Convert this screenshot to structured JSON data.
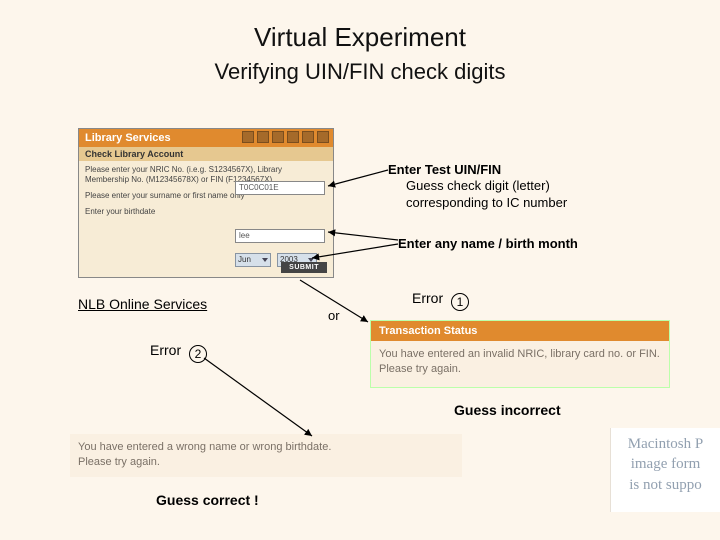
{
  "title": "Virtual Experiment",
  "subtitle": "Verifying UIN/FIN check digits",
  "form": {
    "header": "Library Services",
    "section": "Check Library Account",
    "prompt_nric": "Please enter your NRIC No. (i.e.g. S1234567X), Library Membership No. (M12345678X) or FIN (F1234567X)",
    "nric_value": "T0C0C01E",
    "prompt_name": "Please enter your surname or first name only",
    "name_value": "lee",
    "prompt_birth": "Enter your birthdate",
    "month": "Jun",
    "year": "2003",
    "submit": "SUBMIT"
  },
  "annotations": {
    "nric_title": "Enter Test UIN/FIN",
    "nric_sub1": "Guess check digit (letter)",
    "nric_sub2": "corresponding to IC number",
    "name": "Enter any name / birth month"
  },
  "nlb_label": "NLB Online Services",
  "or": "or",
  "error_label": "Error",
  "error1_num": "1",
  "error2_num": "2",
  "transaction": {
    "header": "Transaction Status",
    "line1": "You have entered an invalid NRIC, library card no. or FIN.",
    "line2": "Please try again."
  },
  "guess_incorrect": "Guess incorrect",
  "wrongname": {
    "line1": "You have entered a wrong name or wrong birthdate.",
    "line2": "Please try again."
  },
  "guess_correct": "Guess correct !",
  "mac": {
    "l1": "Macintosh P",
    "l2": "image form",
    "l3": "is not suppo"
  }
}
